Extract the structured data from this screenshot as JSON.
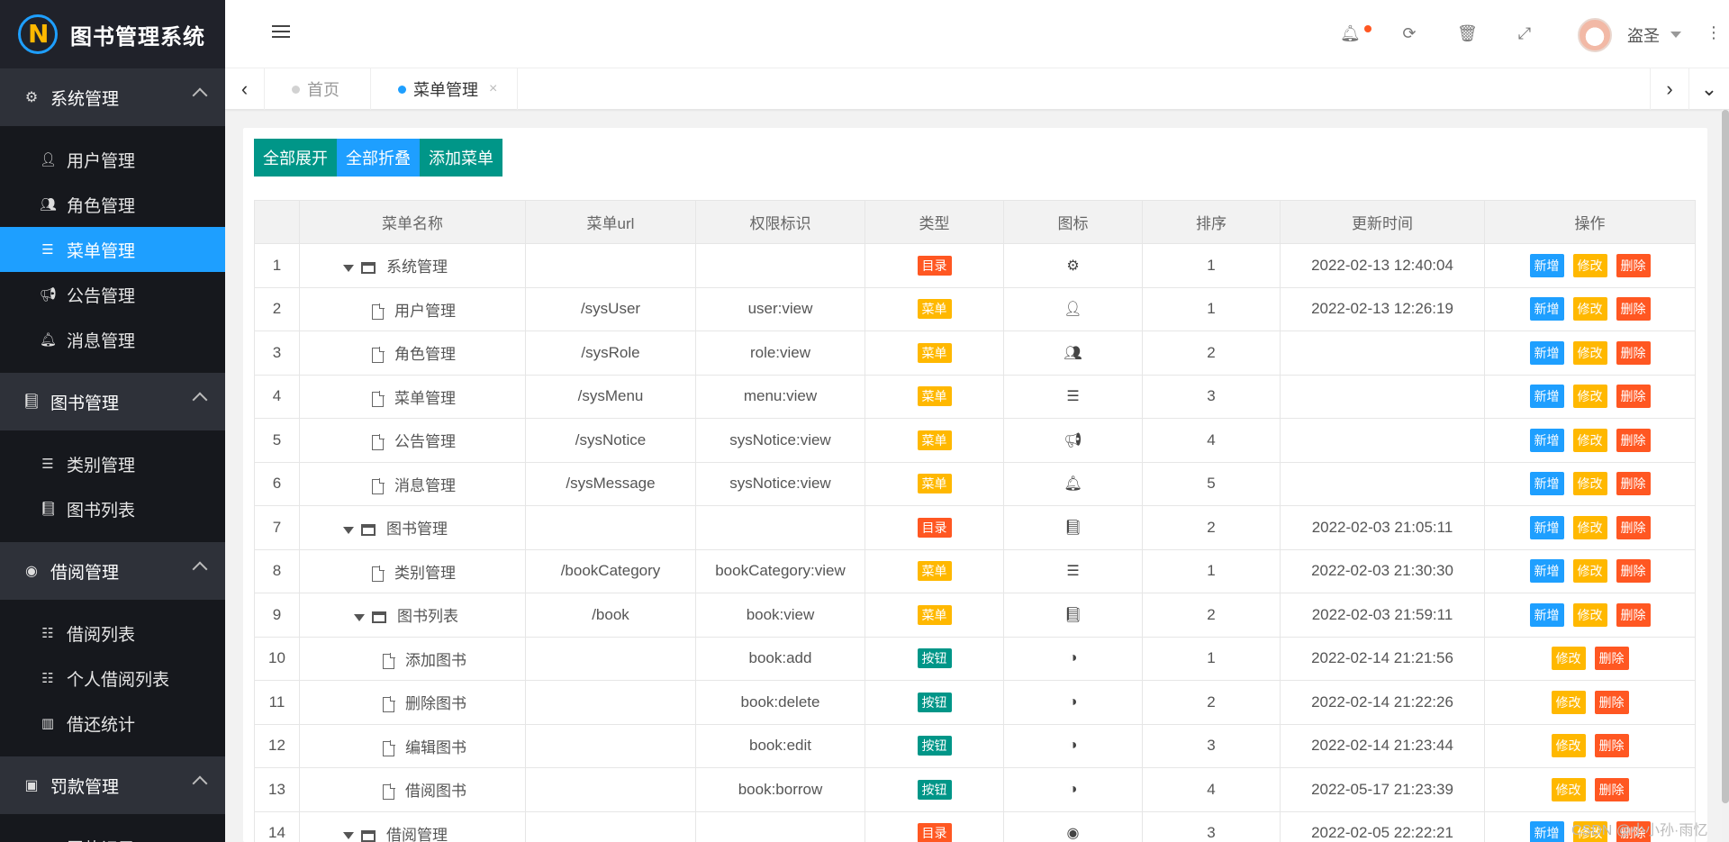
{
  "app": {
    "title": "图书管理系统"
  },
  "sidebar": {
    "groups": [
      {
        "label": "系统管理",
        "icon": "gear-icon",
        "items": [
          {
            "label": "用户管理",
            "icon": "user-icon"
          },
          {
            "label": "角色管理",
            "icon": "users-icon"
          },
          {
            "label": "菜单管理",
            "icon": "list-icon",
            "active": true
          },
          {
            "label": "公告管理",
            "icon": "bullhorn-icon"
          },
          {
            "label": "消息管理",
            "icon": "bell-icon"
          }
        ]
      },
      {
        "label": "图书管理",
        "icon": "book-icon",
        "items": [
          {
            "label": "类别管理",
            "icon": "list-icon"
          },
          {
            "label": "图书列表",
            "icon": "book-icon"
          }
        ]
      },
      {
        "label": "借阅管理",
        "icon": "compass-icon",
        "items": [
          {
            "label": "借阅列表",
            "icon": "list-ul-icon"
          },
          {
            "label": "个人借阅列表",
            "icon": "list-ul-icon"
          },
          {
            "label": "借还统计",
            "icon": "bar-chart-icon"
          }
        ]
      },
      {
        "label": "罚款管理",
        "icon": "money-icon",
        "items": [
          {
            "label": "罚款记录",
            "icon": "money-icon"
          }
        ]
      }
    ]
  },
  "header": {
    "username": "盗圣"
  },
  "tabs": [
    {
      "label": "首页",
      "active": false
    },
    {
      "label": "菜单管理",
      "active": true,
      "closable": true
    }
  ],
  "toolbar": {
    "expand_all": "全部展开",
    "collapse_all": "全部折叠",
    "add_menu": "添加菜单"
  },
  "table": {
    "columns": [
      "",
      "菜单名称",
      "菜单url",
      "权限标识",
      "类型",
      "图标",
      "排序",
      "更新时间",
      "操作"
    ],
    "rows": [
      {
        "no": "1",
        "level": 0,
        "folder": true,
        "name": "系统管理",
        "url": "",
        "perm": "",
        "type": "目录",
        "type_color": "red",
        "icon": "gear-icon",
        "sort": "1",
        "time": "2022-02-13 12:40:04",
        "ops": [
          "新增",
          "修改",
          "删除"
        ]
      },
      {
        "no": "2",
        "level": 1,
        "folder": false,
        "name": "用户管理",
        "url": "/sysUser",
        "perm": "user:view",
        "type": "菜单",
        "type_color": "orange",
        "icon": "user-icon",
        "sort": "1",
        "time": "2022-02-13 12:26:19",
        "ops": [
          "新增",
          "修改",
          "删除"
        ]
      },
      {
        "no": "3",
        "level": 1,
        "folder": false,
        "name": "角色管理",
        "url": "/sysRole",
        "perm": "role:view",
        "type": "菜单",
        "type_color": "orange",
        "icon": "users-icon",
        "sort": "2",
        "time": "",
        "ops": [
          "新增",
          "修改",
          "删除"
        ]
      },
      {
        "no": "4",
        "level": 1,
        "folder": false,
        "name": "菜单管理",
        "url": "/sysMenu",
        "perm": "menu:view",
        "type": "菜单",
        "type_color": "orange",
        "icon": "list-icon",
        "sort": "3",
        "time": "",
        "ops": [
          "新增",
          "修改",
          "删除"
        ]
      },
      {
        "no": "5",
        "level": 1,
        "folder": false,
        "name": "公告管理",
        "url": "/sysNotice",
        "perm": "sysNotice:view",
        "type": "菜单",
        "type_color": "orange",
        "icon": "bullhorn-icon",
        "sort": "4",
        "time": "",
        "ops": [
          "新增",
          "修改",
          "删除"
        ]
      },
      {
        "no": "6",
        "level": 1,
        "folder": false,
        "name": "消息管理",
        "url": "/sysMessage",
        "perm": "sysNotice:view",
        "type": "菜单",
        "type_color": "orange",
        "icon": "bell-icon",
        "sort": "5",
        "time": "",
        "ops": [
          "新增",
          "修改",
          "删除"
        ]
      },
      {
        "no": "7",
        "level": 0,
        "folder": true,
        "name": "图书管理",
        "url": "",
        "perm": "",
        "type": "目录",
        "type_color": "red",
        "icon": "book-icon",
        "sort": "2",
        "time": "2022-02-03 21:05:11",
        "ops": [
          "新增",
          "修改",
          "删除"
        ]
      },
      {
        "no": "8",
        "level": 1,
        "folder": false,
        "name": "类别管理",
        "url": "/bookCategory",
        "perm": "bookCategory:view",
        "type": "菜单",
        "type_color": "orange",
        "icon": "list-icon",
        "sort": "1",
        "time": "2022-02-03 21:30:30",
        "ops": [
          "新增",
          "修改",
          "删除"
        ]
      },
      {
        "no": "9",
        "level": 1,
        "folder": true,
        "name": "图书列表",
        "url": "/book",
        "perm": "book:view",
        "type": "菜单",
        "type_color": "orange",
        "icon": "book-icon",
        "sort": "2",
        "time": "2022-02-03 21:59:11",
        "ops": [
          "新增",
          "修改",
          "删除"
        ]
      },
      {
        "no": "10",
        "level": 2,
        "folder": false,
        "name": "添加图书",
        "url": "",
        "perm": "book:add",
        "type": "按钮",
        "type_color": "teal",
        "icon": "adjust-icon",
        "sort": "1",
        "time": "2022-02-14 21:21:56",
        "ops": [
          "修改",
          "删除"
        ]
      },
      {
        "no": "11",
        "level": 2,
        "folder": false,
        "name": "删除图书",
        "url": "",
        "perm": "book:delete",
        "type": "按钮",
        "type_color": "teal",
        "icon": "adjust-icon",
        "sort": "2",
        "time": "2022-02-14 21:22:26",
        "ops": [
          "修改",
          "删除"
        ]
      },
      {
        "no": "12",
        "level": 2,
        "folder": false,
        "name": "编辑图书",
        "url": "",
        "perm": "book:edit",
        "type": "按钮",
        "type_color": "teal",
        "icon": "adjust-icon",
        "sort": "3",
        "time": "2022-02-14 21:23:44",
        "ops": [
          "修改",
          "删除"
        ]
      },
      {
        "no": "13",
        "level": 2,
        "folder": false,
        "name": "借阅图书",
        "url": "",
        "perm": "book:borrow",
        "type": "按钮",
        "type_color": "teal",
        "icon": "adjust-icon",
        "sort": "4",
        "time": "2022-05-17 21:23:39",
        "ops": [
          "修改",
          "删除"
        ]
      },
      {
        "no": "14",
        "level": 0,
        "folder": true,
        "name": "借阅管理",
        "url": "",
        "perm": "",
        "type": "目录",
        "type_color": "red",
        "icon": "compass-icon",
        "sort": "3",
        "time": "2022-02-05 22:22:21",
        "ops": [
          "新增",
          "修改",
          "删除"
        ]
      }
    ]
  },
  "watermark": "CSDN @小小孙·雨忆"
}
